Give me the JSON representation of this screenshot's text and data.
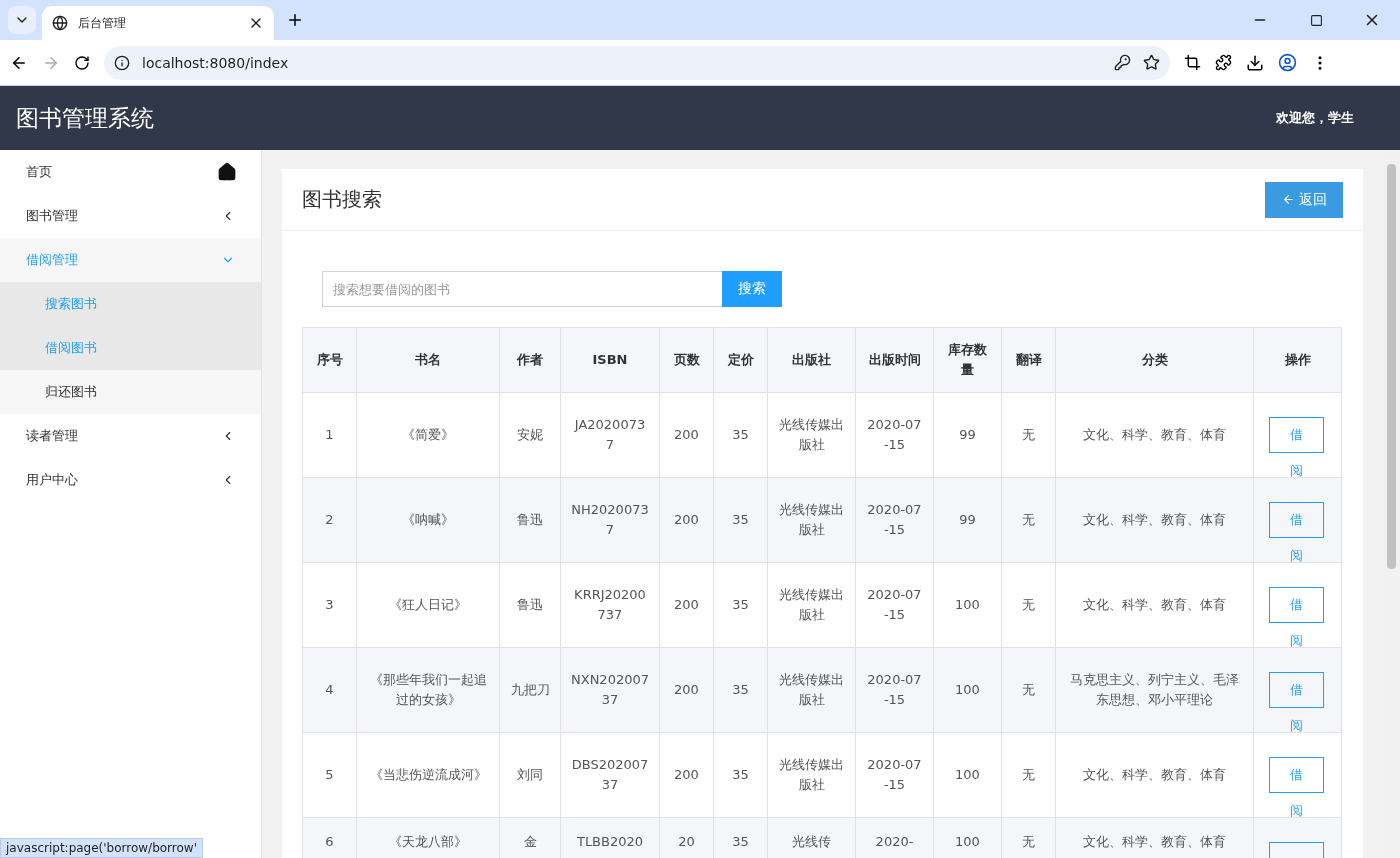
{
  "browser": {
    "tab_title": "后台管理",
    "url": "localhost:8080/index",
    "status_text": "javascript:page('borrow/borrow'"
  },
  "header": {
    "title": "图书管理系统",
    "welcome": "欢迎您，学生"
  },
  "sidebar": {
    "items": [
      {
        "label": "首页",
        "kind": "home",
        "selected": false
      },
      {
        "label": "图书管理",
        "kind": "menu",
        "expanded": false,
        "selected": false
      },
      {
        "label": "借阅管理",
        "kind": "menu",
        "expanded": true,
        "selected": true,
        "children": [
          {
            "label": "搜索图书",
            "selected": true
          },
          {
            "label": "借阅图书",
            "selected": true
          },
          {
            "label": "归还图书",
            "selected": false
          }
        ]
      },
      {
        "label": "读者管理",
        "kind": "menu",
        "expanded": false,
        "selected": false
      },
      {
        "label": "用户中心",
        "kind": "menu",
        "expanded": false,
        "selected": false
      }
    ]
  },
  "card": {
    "title": "图书搜索",
    "back_button": "返回"
  },
  "search": {
    "placeholder": "搜索想要借阅的图书",
    "button": "搜索"
  },
  "table": {
    "columns": [
      "序号",
      "书名",
      "作者",
      "ISBN",
      "页数",
      "定价",
      "出版社",
      "出版时间",
      "库存数量",
      "翻译",
      "分类",
      "操作"
    ],
    "rows": [
      {
        "cells": [
          "1",
          "《简爱》",
          "安妮",
          "JA20200737",
          "200",
          "35",
          "光线传媒出版社",
          "2020-07-15",
          "99",
          "无",
          "文化、科学、教育、体育"
        ],
        "action": "借阅"
      },
      {
        "cells": [
          "2",
          "《呐喊》",
          "鲁迅",
          "NH20200737",
          "200",
          "35",
          "光线传媒出版社",
          "2020-07-15",
          "99",
          "无",
          "文化、科学、教育、体育"
        ],
        "action": "借阅"
      },
      {
        "cells": [
          "3",
          "《狂人日记》",
          "鲁迅",
          "KRRJ20200737",
          "200",
          "35",
          "光线传媒出版社",
          "2020-07-15",
          "100",
          "无",
          "文化、科学、教育、体育"
        ],
        "action": "借阅"
      },
      {
        "cells": [
          "4",
          "《那些年我们一起追过的女孩》",
          "九把刀",
          "NXN20200737",
          "200",
          "35",
          "光线传媒出版社",
          "2020-07-15",
          "100",
          "无",
          "马克思主义、列宁主义、毛泽东思想、邓小平理论"
        ],
        "action": "借阅"
      },
      {
        "cells": [
          "5",
          "《当悲伤逆流成河》",
          "刘同",
          "DBS20200737",
          "200",
          "35",
          "光线传媒出版社",
          "2020-07-15",
          "100",
          "无",
          "文化、科学、教育、体育"
        ],
        "action": "借阅"
      },
      {
        "kind": "partial",
        "cells": [
          "6",
          "《天龙八部》",
          "金",
          "TLBB2020",
          "20",
          "35",
          "光线传",
          "2020-",
          "100",
          "无",
          "文化、科学、教育、体育"
        ]
      }
    ]
  }
}
